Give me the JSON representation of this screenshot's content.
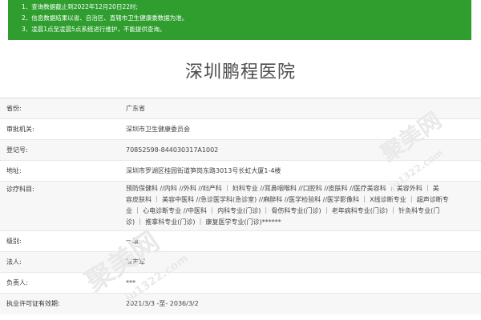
{
  "notice": {
    "lines": [
      "1、查询数据截止到2022年12月20日22时;",
      "2、信息数据结果以省、自治区、直辖市卫生健康委数据为准。",
      "3、凌晨1点至凌晨5点系统进行维护，不能提供查询。"
    ]
  },
  "hospital_name": "深圳鹏程医院",
  "fields": [
    {
      "label": "省份:",
      "value": "广东省"
    },
    {
      "label": "审批机关:",
      "value": "深圳市卫生健康委员会"
    },
    {
      "label": "登记号:",
      "value": "70852598-844030317A1002"
    },
    {
      "label": "地址:",
      "value": "深圳市罗湖区桂园街道笋岗东路3013号长虹大厦1-4楼"
    },
    {
      "label": "诊疗科目:",
      "value_lines": [
        "预防保健科 //内科 //外科 //妇产科 ｜ 妇科专业 //耳鼻咽喉科 //口腔科 //皮肤科 //医疗美容科 ｜ 美容外科 ｜ 美",
        "容皮肤科 ｜ 美容中医科 //急诊医学科(急诊室) //麻醉科 //医学检验科 //医学影像科 ｜ X线诊断专业 ｜ 超声诊断专",
        "业 ｜ 心电诊断专业 //中医科 ｜ 内科专业(门诊) ｜ 骨伤科专业(门诊) ｜ 老年病科专业(门诊) ｜ 针灸科专业(门",
        "诊) ｜ 推拿科专业(门诊) ｜ 康复医学专业(门诊)******"
      ]
    },
    {
      "label": "级别:",
      "value": "一级"
    },
    {
      "label": "法人:",
      "value": "徐志军"
    },
    {
      "label": "负责人:",
      "value": "***"
    },
    {
      "label": "执业许可证有效期:",
      "value": "2021/3/3 -至- 2036/3/2"
    }
  ],
  "watermark": {
    "text_cn": "聚美网",
    "text_url": "ju1322.com"
  }
}
